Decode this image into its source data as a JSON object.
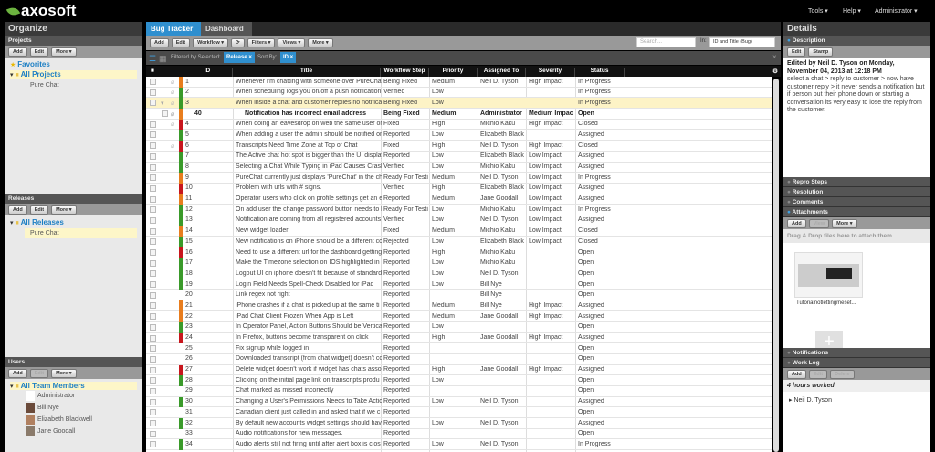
{
  "app": {
    "logo": "axosoft",
    "menu": [
      "Tools ▾",
      "Help ▾",
      "Administrator ▾"
    ]
  },
  "organize": {
    "title": "Organize",
    "projects": {
      "header": "Projects",
      "buttons": [
        "Add",
        "Edit",
        "More ▾"
      ],
      "favorites": "Favorites",
      "all": "All Projects",
      "items": [
        "Pure Chat"
      ]
    },
    "releases": {
      "header": "Releases",
      "buttons": [
        "Add",
        "Edit",
        "More ▾"
      ],
      "all": "All Releases",
      "items": [
        "Pure Chat"
      ]
    },
    "users": {
      "header": "Users",
      "buttons": [
        "Add",
        "Edit",
        "More ▾"
      ],
      "all": "All Team Members",
      "items": [
        "Administrator",
        "Bill Nye",
        "Elizabeth Blackwell",
        "Jane Goodall"
      ]
    }
  },
  "tabs": [
    "Bug Tracker",
    "Dashboard"
  ],
  "toolbar": {
    "buttons": [
      "Add",
      "Edit",
      "Workflow ▾",
      "⟳",
      "Filters ▾",
      "Views ▾",
      "More ▾"
    ],
    "search_placeholder": "Search...",
    "in_label": "In:",
    "in_value": "ID and Title (Bug)"
  },
  "filterbar": {
    "filtered_label": "Filtered by Selected:",
    "filter_chip": "Release",
    "sort_label": "Sort By:",
    "sort_chip": "ID"
  },
  "columns": [
    "ID",
    "Title",
    "Workflow Step",
    "Priority",
    "Assigned To",
    "Severity",
    "Status"
  ],
  "colors": {
    "High": "#c8161d",
    "Medium": "#e87d1e",
    "Low": "#3a9a2a"
  },
  "rows": [
    [
      "1",
      "Whenever I'm chatting with someone over PureChat",
      "Being Fixed",
      "Medium",
      "Neil D. Tyson",
      "High Impact",
      "In Progress",
      1,
      0
    ],
    [
      "2",
      "When scheduling logs you on/off a push notification",
      "Verified",
      "Low",
      "",
      "",
      "In Progress",
      1,
      0
    ],
    [
      "3",
      "When inside a chat and customer replies no notification",
      "Being Fixed",
      "Low",
      "",
      "",
      "In Progress",
      1,
      1
    ],
    [
      "40",
      "Notification has incorrect email address",
      "Being Fixed",
      "Medium",
      "Administrator",
      "Medium Impac",
      "Open",
      1,
      2
    ],
    [
      "4",
      "When doing an eavesdrop on web the same user on",
      "Fixed",
      "High",
      "Michio Kaku",
      "High Impact",
      "Closed",
      1,
      0
    ],
    [
      "5",
      "When adding a user the admin should be notified on",
      "Reported",
      "Low",
      "Elizabeth Black",
      "",
      "Assigned",
      0,
      0
    ],
    [
      "6",
      "Transcripts Need Time Zone at Top of Chat",
      "Fixed",
      "High",
      "Neil D. Tyson",
      "High Impact",
      "Closed",
      1,
      0
    ],
    [
      "7",
      "The Active chat hot spot is bigger than the UI display",
      "Reported",
      "Low",
      "Elizabeth Black",
      "Low Impact",
      "Assigned",
      0,
      0
    ],
    [
      "8",
      "Selecting a Chat While Typing in iPad Causes Crash",
      "Verified",
      "Low",
      "Michio Kaku",
      "Low Impact",
      "Assigned",
      0,
      0
    ],
    [
      "9",
      "PureChat currently just displays 'PureChat' in the ch",
      "Ready For Testi",
      "Medium",
      "Neil D. Tyson",
      "Low Impact",
      "In Progress",
      0,
      0
    ],
    [
      "10",
      "Problem with urls with # signs.",
      "Verified",
      "High",
      "Elizabeth Black",
      "Low Impact",
      "Assigned",
      0,
      0
    ],
    [
      "11",
      "Operator users who click on profile settings get an e",
      "Reported",
      "Medium",
      "Jane Goodall",
      "Low Impact",
      "Assigned",
      0,
      0
    ],
    [
      "12",
      "On add user the change password button needs to b",
      "Ready For Testi",
      "Low",
      "Michio Kaku",
      "Low Impact",
      "In Progress",
      0,
      0
    ],
    [
      "13",
      "Notification are coming from all registered accounts",
      "Verified",
      "Low",
      "Neil D. Tyson",
      "Low Impact",
      "Assigned",
      0,
      0
    ],
    [
      "14",
      "New widget loader",
      "Fixed",
      "Medium",
      "Michio Kaku",
      "Low Impact",
      "Closed",
      0,
      0
    ],
    [
      "15",
      "New notifications on iPhone should be a different co",
      "Rejected",
      "Low",
      "Elizabeth Black",
      "Low Impact",
      "Closed",
      0,
      0
    ],
    [
      "16",
      "Need to use a different url for the dashboard getting",
      "Reported",
      "High",
      "Michio Kaku",
      "",
      "Open",
      0,
      0
    ],
    [
      "17",
      "Make the Timezone selection on IOS highlighted in",
      "Reported",
      "Low",
      "Michio Kaku",
      "",
      "Open",
      0,
      0
    ],
    [
      "18",
      "Logout UI on iphone doesn't fit because of standard",
      "Reported",
      "Low",
      "Neil D. Tyson",
      "",
      "Open",
      0,
      0
    ],
    [
      "19",
      "Login Field Needs Spell-Check Disabled for iPad",
      "Reported",
      "Low",
      "Bill Nye",
      "",
      "Open",
      0,
      0
    ],
    [
      "20",
      "Link regex not right",
      "Reported",
      "",
      "Bill Nye",
      "",
      "Open",
      0,
      0
    ],
    [
      "21",
      "iPhone crashes if a chat is picked up at the same ti",
      "Reported",
      "Medium",
      "Bill Nye",
      "High Impact",
      "Assigned",
      0,
      0
    ],
    [
      "22",
      "iPad Chat Client Frozen When App is Left",
      "Reported",
      "Medium",
      "Jane Goodall",
      "High Impact",
      "Assigned",
      0,
      0
    ],
    [
      "23",
      "In Operator Panel, Action Buttons Should be Vertica",
      "Reported",
      "Low",
      "",
      "",
      "Open",
      0,
      0
    ],
    [
      "24",
      "In Firefox, buttons become transparent on click",
      "Reported",
      "High",
      "Jane Goodall",
      "High Impact",
      "Assigned",
      0,
      0
    ],
    [
      "25",
      "Fix signup while logged in",
      "Reported",
      "",
      "",
      "",
      "Open",
      0,
      0
    ],
    [
      "26",
      "Downloaded transcript (from chat widget) doesn't co",
      "Reported",
      "",
      "",
      "",
      "Open",
      0,
      0
    ],
    [
      "27",
      "Delete widget doesn't work if widget has chats asso",
      "Reported",
      "High",
      "Jane Goodall",
      "High Impact",
      "Assigned",
      0,
      0
    ],
    [
      "28",
      "Clicking on the initial page link on transcripts produ",
      "Reported",
      "Low",
      "",
      "",
      "Open",
      0,
      0
    ],
    [
      "29",
      "Chat marked as missed incorrectly",
      "Reported",
      "",
      "",
      "",
      "Open",
      0,
      0
    ],
    [
      "30",
      "Changing a User's Permissions Needs to Take Actio",
      "Reported",
      "Low",
      "Neil D. Tyson",
      "",
      "Assigned",
      0,
      0
    ],
    [
      "31",
      "Canadian client just called in and asked that if we c",
      "Reported",
      "",
      "",
      "",
      "Open",
      0,
      0
    ],
    [
      "32",
      "By default new accounts widget settings should hav",
      "Reported",
      "Low",
      "Neil D. Tyson",
      "",
      "Assigned",
      0,
      0
    ],
    [
      "33",
      "Audio notifications for new messages.",
      "Reported",
      "",
      "",
      "",
      "Open",
      0,
      0
    ],
    [
      "34",
      "Audio alerts still not firing until after alert box is clos",
      "Reported",
      "Low",
      "Neil D. Tyson",
      "",
      "In Progress",
      0,
      0
    ]
  ],
  "details": {
    "title": "Details",
    "description": "Description",
    "desc_buttons": [
      "Edit",
      "Stamp"
    ],
    "edited_by": "Edited by Neil D. Tyson on Monday, November 04, 2013 at 12:18 PM",
    "body": "select a chat > reply to customer > now have customer reply > it never sends a notification but if person put their phone down or starting a conversation its very easy to lose the reply from the customer.",
    "sections": [
      "Repro Steps",
      "Resolution",
      "Comments",
      "Attachments"
    ],
    "attach_buttons": [
      "Add",
      "View",
      "More ▾"
    ],
    "drop_hint": "Drag & Drop files here to attach them.",
    "attachment_name": "Tutorialnotlettingmeset...",
    "sections2": [
      "Notifications",
      "Work Log"
    ],
    "worklog_buttons": [
      "Add",
      "Edit",
      "Delete"
    ],
    "hours": "4 hours worked",
    "worklog_user": "Neil D. Tyson"
  }
}
